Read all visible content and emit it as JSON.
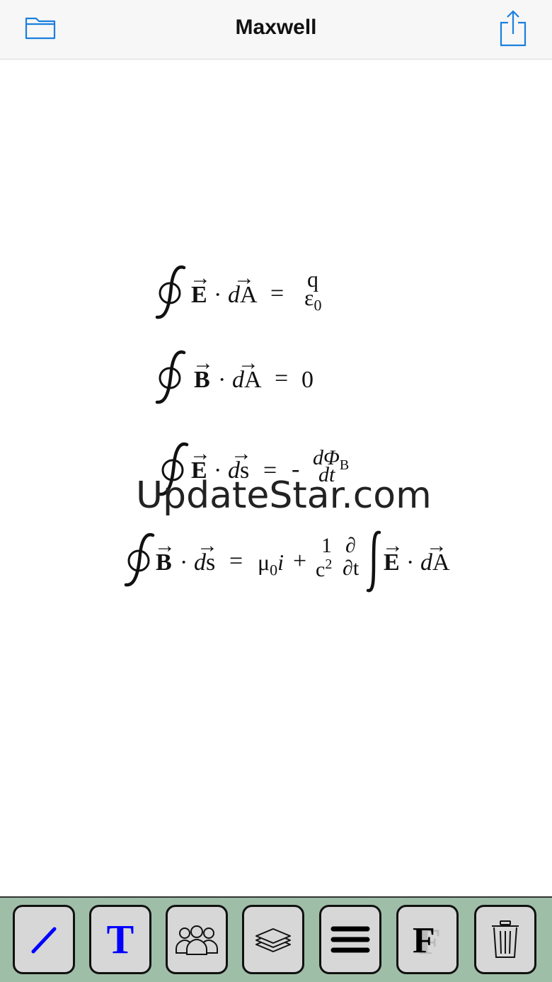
{
  "header": {
    "title": "Maxwell",
    "folder_icon": "folder-icon",
    "share_icon": "share-icon"
  },
  "equations": {
    "eq1": {
      "lhs1": "E",
      "dot": "·",
      "lhs2": "d",
      "lhs3": "A",
      "eq": "=",
      "num": "q",
      "den": "ε",
      "den_sub": "0"
    },
    "eq2": {
      "lhs1": "B",
      "dot": "·",
      "lhs2": "d",
      "lhs3": "A",
      "eq": "=",
      "rhs": "0"
    },
    "eq3": {
      "lhs1": "E",
      "dot": "·",
      "lhs2": "d",
      "lhs3": "s",
      "eq": "=",
      "minus": "-",
      "num": "dΦ",
      "num_sub": "B",
      "den": "dt"
    },
    "eq4": {
      "lhs1": "B",
      "dot": "·",
      "lhs2": "d",
      "lhs3": "s",
      "eq": "=",
      "mu": "μ",
      "mu_sub": "0",
      "i": "i",
      "plus": "+",
      "frac1_num": "1",
      "frac1_den": "c",
      "frac1_den_sup": "2",
      "frac2_num": "∂",
      "frac2_den": "∂t",
      "r1": "E",
      "r_dot": "·",
      "r2": "d",
      "r3": "A"
    }
  },
  "watermark": "UpdateStar.com",
  "toolbar": {
    "tools": [
      "pen-tool",
      "text-tool",
      "group-tool",
      "layers-tool",
      "menu-tool",
      "font-tool",
      "trash-tool"
    ],
    "text_tool_label": "T",
    "font_tool_label": "F",
    "accent_color": "#0000ff",
    "background_color": "#9fbea7"
  }
}
